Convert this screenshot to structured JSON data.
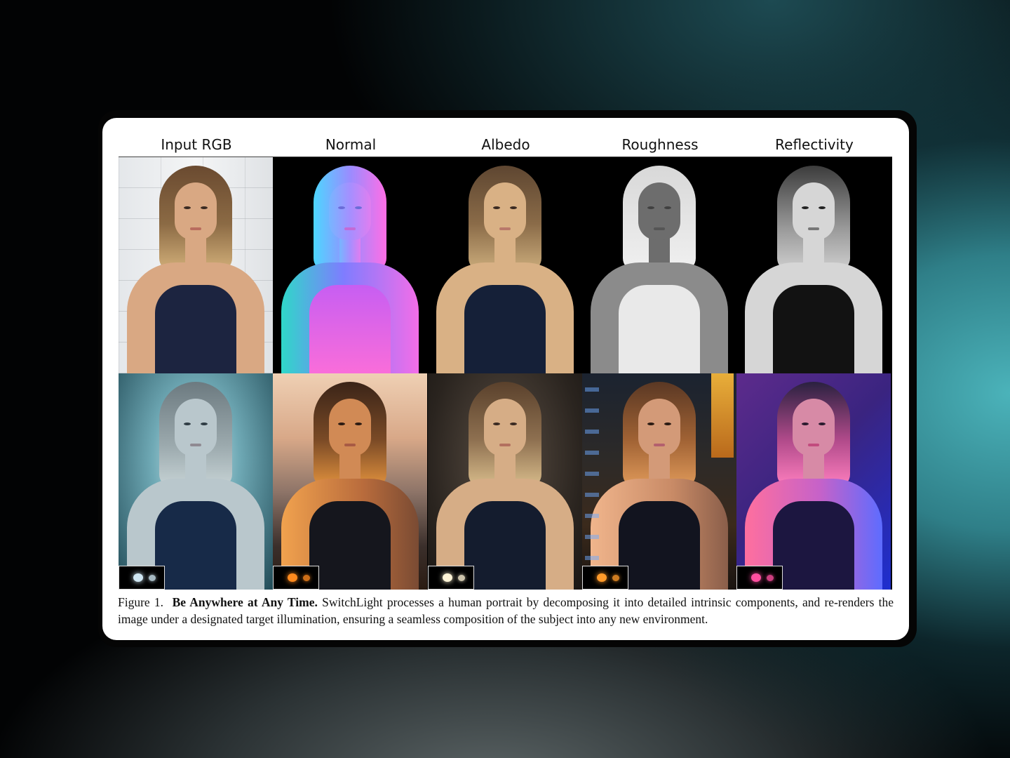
{
  "figure": {
    "column_labels": [
      "Input RGB",
      "Normal",
      "Albedo",
      "Roughness",
      "Reflectivity"
    ],
    "caption": {
      "number": "Figure 1.",
      "title": "Be Anywhere at Any Time.",
      "text": "SwitchLight processes a human portrait by decomposing it into detailed intrinsic components, and re-renders the image under a designated target illumination, ensuring a seamless composition of the subject into any new environment."
    },
    "top_row": [
      {
        "name": "input-rgb-portrait",
        "variant": "v-rgb",
        "background": "bg-wall"
      },
      {
        "name": "normal-map-portrait",
        "variant": "v-normal",
        "background": "bg-black"
      },
      {
        "name": "albedo-portrait",
        "variant": "v-albedo",
        "background": "bg-black"
      },
      {
        "name": "roughness-portrait",
        "variant": "v-rough",
        "background": "bg-black"
      },
      {
        "name": "reflectivity-portrait",
        "variant": "v-refl",
        "background": "bg-black"
      }
    ],
    "bottom_row": [
      {
        "name": "relit-ice-portrait",
        "variant": "v-ice",
        "background": "bg-ice",
        "env_color": "#cfe6f2"
      },
      {
        "name": "relit-sunset-portrait",
        "variant": "v-sun",
        "background": "bg-sunset",
        "env_color": "#ff8a1e"
      },
      {
        "name": "relit-studio-portrait",
        "variant": "v-studio",
        "background": "bg-studio",
        "env_color": "#fff4d6"
      },
      {
        "name": "relit-city-portrait",
        "variant": "v-city",
        "background": "bg-city",
        "env_color": "#ff9a2a"
      },
      {
        "name": "relit-neon-portrait",
        "variant": "v-neon",
        "background": "bg-neon",
        "env_color": "#ff4fa0"
      }
    ]
  }
}
